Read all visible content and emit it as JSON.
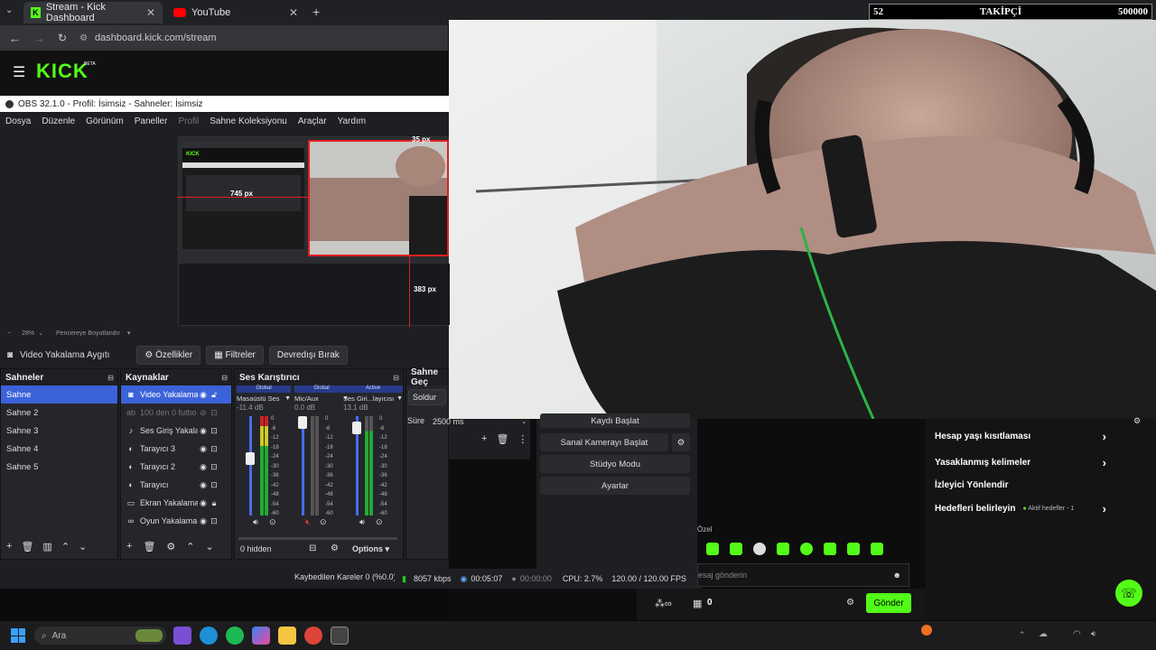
{
  "browser": {
    "tabs": [
      {
        "title": "Stream - Kick Dashboard",
        "icon": "kick-icon"
      },
      {
        "title": "YouTube",
        "icon": "youtube-icon"
      }
    ],
    "new_tab": "+",
    "url": "dashboard.kick.com/stream"
  },
  "stat_overlay": {
    "left": "52",
    "label": "TAKİPÇİ",
    "right": "500000"
  },
  "kick": {
    "logo": "KICK",
    "badge": "BETA"
  },
  "obs": {
    "title": "OBS 32.1.0 - Profil: İsimsiz - Sahneler: İsimsiz",
    "menu": [
      "Dosya",
      "Düzenle",
      "Görünüm",
      "Paneller",
      "Profil",
      "Sahne Koleksiyonu",
      "Araçlar",
      "Yardım"
    ],
    "preview_labels": {
      "top": "35 px",
      "left": "745 px",
      "bottom": "383 px"
    },
    "zoom": "28%",
    "zoom_mode": "Pencereye Boyutlandır",
    "source_toolbar": {
      "source_name": "Video Yakalama Aygıtı",
      "properties": "Özellikler",
      "filters": "Filtreler",
      "deactivate": "Devredışı Bırak"
    },
    "scenes": {
      "header": "Sahneler",
      "items": [
        "Sahne",
        "Sahne 2",
        "Sahne 3",
        "Sahne 4",
        "Sahne 5"
      ]
    },
    "sources": {
      "header": "Kaynaklar",
      "items": [
        "Video Yakalama",
        "100 den 0 futbo",
        "Ses Giriş Yakala",
        "Tarayıcı 3",
        "Tarayıcı 2",
        "Tarayıcı",
        "Ekran Yakalama",
        "Oyun Yakalama"
      ]
    },
    "mixer": {
      "header": "Ses Karıştırıcı",
      "channels": [
        {
          "tag": "Global",
          "name": "Masaüstü Ses",
          "db": "-11.4 dB"
        },
        {
          "tag": "Global",
          "name": "Mic/Aux",
          "db": "0.0 dB"
        },
        {
          "tag": "Active",
          "name": "Ses Giri...layıcısı",
          "db": "13.1 dB"
        }
      ],
      "scale": [
        "0",
        "-6",
        "-12",
        "-18",
        "-24",
        "-30",
        "-36",
        "-42",
        "-48",
        "-54",
        "-60"
      ],
      "hidden": "0 hidden",
      "options": "Options"
    },
    "transitions": {
      "header": "Sahne Geç",
      "type": "Soldur",
      "duration_label": "Süre",
      "duration": "2500 ms"
    },
    "controls": {
      "record": "Kaydı Başlat",
      "virtual_cam": "Sanal Kamerayı Başlat",
      "studio": "Stüdyo Modu",
      "settings": "Ayarlar"
    },
    "status": {
      "dropped": "Kaybedilen Kareler 0 (%0.0)",
      "bitrate": "8057 kbps",
      "stream_time": "00:05:07",
      "rec_time": "00:00:00",
      "cpu": "CPU: 2.7%",
      "fps": "120.00 / 120.00 FPS"
    }
  },
  "kick_panel": {
    "mod_items": [
      {
        "label": "Hesap yaşı kısıtlaması"
      },
      {
        "label": "Yasaklanmış kelimeler"
      },
      {
        "label": "İzleyici Yönlendir"
      },
      {
        "label": "Hedefleri belirleyin",
        "extra": "Aktif hedefler - 1"
      }
    ],
    "emote_label": "Özel",
    "chat_placeholder": "esaj gönderin",
    "points": "0",
    "send": "Gönder"
  },
  "taskbar": {
    "search": "Ara"
  }
}
